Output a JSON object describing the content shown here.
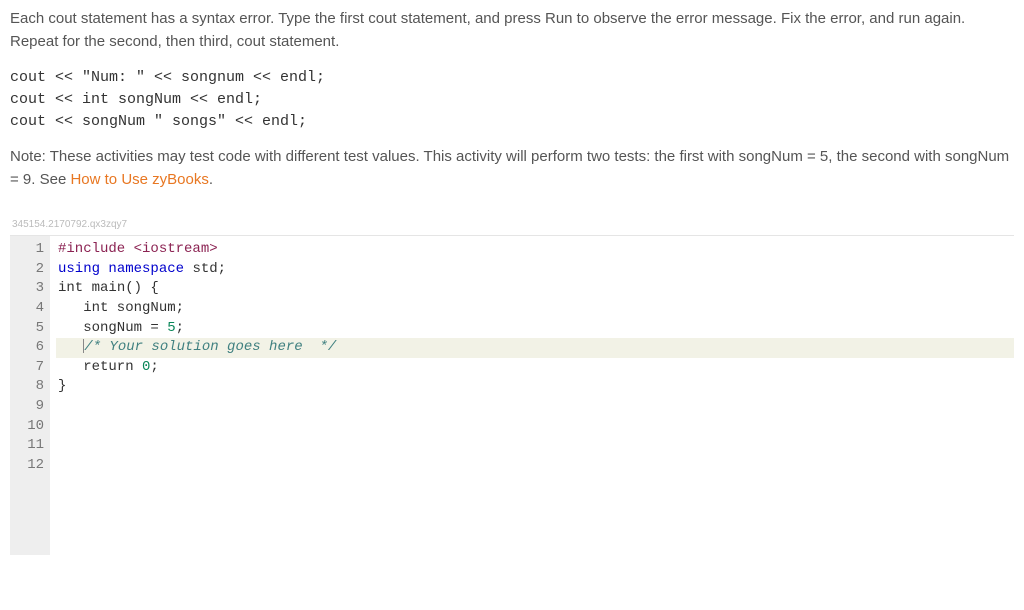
{
  "instructions": {
    "p1": "Each cout statement has a syntax error. Type the first cout statement, and press Run to observe the error message. Fix the error, and run again. Repeat for the second, then third, cout statement.",
    "example_line1": "cout << \"Num: \" << songnum << endl;",
    "example_line2": "cout << int songNum << endl;",
    "example_line3": "cout << songNum \" songs\" << endl;",
    "note_prefix": "Note: These activities may test code with different test values. This activity will perform two tests: the first with songNum = 5, the second with songNum = 9. See ",
    "note_link": "How to Use zyBooks",
    "note_suffix": "."
  },
  "watermark": "345154.2170792.qx3zqy7",
  "editor": {
    "lines": {
      "l1_pp": "#include ",
      "l1_lib": "<iostream>",
      "l2_kw": "using ",
      "l2_ns": "namespace",
      "l2_std": " std",
      "l2_semi": ";",
      "l3": "",
      "l4_type": "int ",
      "l4_fn": "main",
      "l4_paren": "() {",
      "l5": "   int songNum;",
      "l6": "",
      "l7_a": "   songNum = ",
      "l7_num": "5",
      "l7_semi": ";",
      "l8": "",
      "l9_indent": "   ",
      "l9_comment": "/* Your solution goes here  */",
      "l10": "",
      "l11_a": "   return ",
      "l11_num": "0",
      "l11_semi": ";",
      "l12": "}"
    },
    "gutter": [
      "1",
      "2",
      "3",
      "4",
      "5",
      "6",
      "7",
      "8",
      "9",
      "10",
      "11",
      "12"
    ]
  }
}
